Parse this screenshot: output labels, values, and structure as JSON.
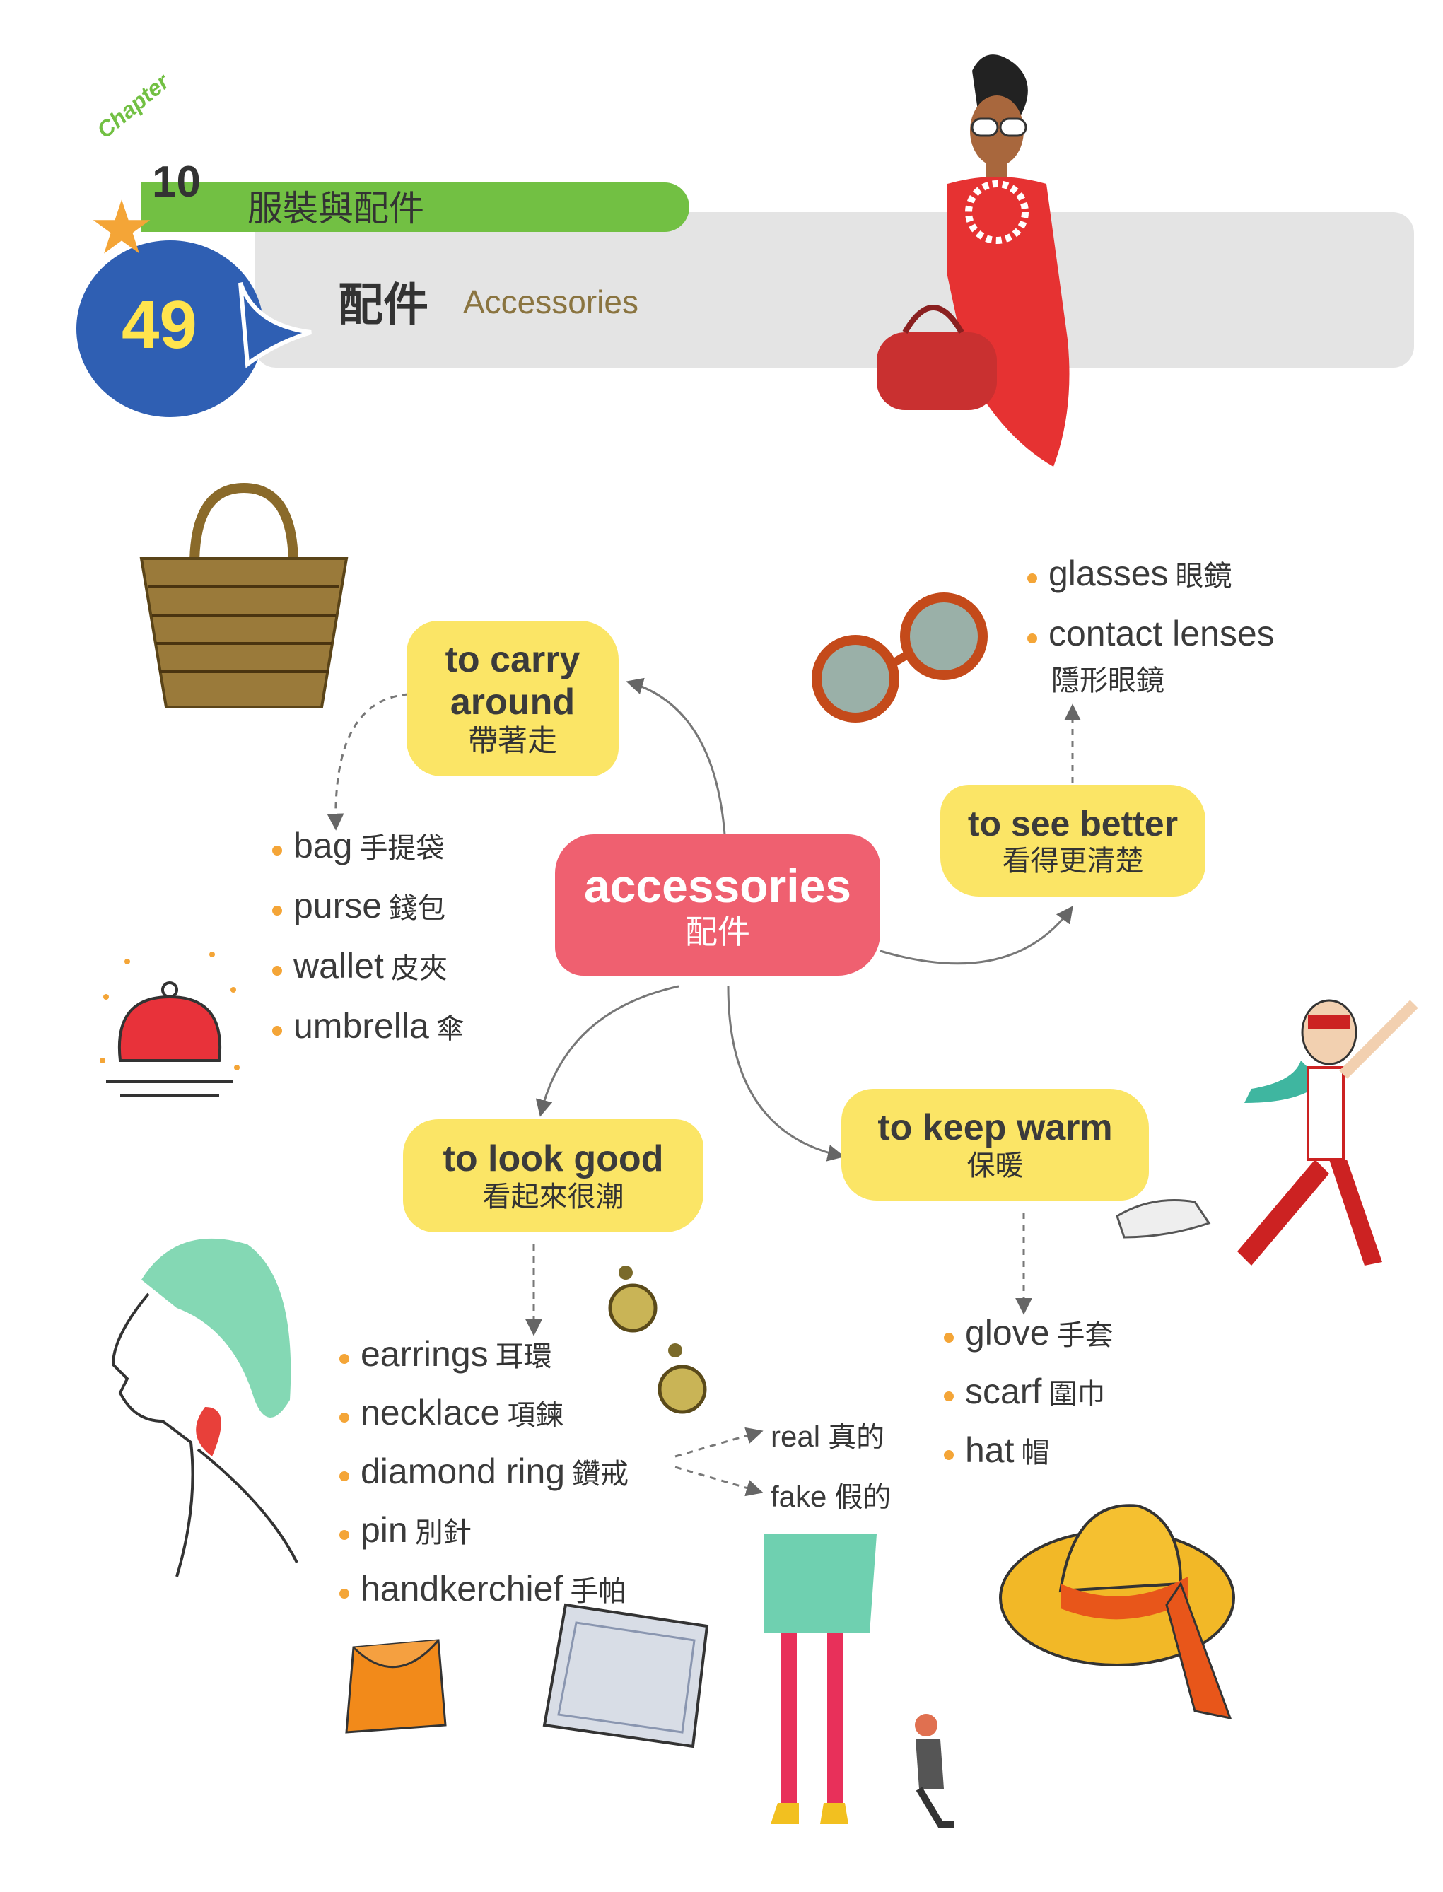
{
  "header": {
    "chapter_word": "Chapter",
    "chapter_number": "10",
    "chapter_title": "服裝與配件",
    "unit_number": "49",
    "unit_title_cn": "配件",
    "unit_title_en": "Accessories"
  },
  "center": {
    "en": "accessories",
    "cn": "配件"
  },
  "branches": {
    "carry": {
      "en_line1": "to carry",
      "en_line2": "around",
      "cn": "帶著走",
      "items": [
        {
          "en": "bag",
          "cn": "手提袋"
        },
        {
          "en": "purse",
          "cn": "錢包"
        },
        {
          "en": "wallet",
          "cn": "皮夾"
        },
        {
          "en": "umbrella",
          "cn": "傘"
        }
      ]
    },
    "see": {
      "en": "to see better",
      "cn": "看得更清楚",
      "items": [
        {
          "en": "glasses",
          "cn": "眼鏡"
        },
        {
          "en": "contact lenses",
          "cn": ""
        }
      ],
      "contact_lenses_cn": "隱形眼鏡"
    },
    "look": {
      "en": "to look good",
      "cn": "看起來很潮",
      "items": [
        {
          "en": "earrings",
          "cn": "耳環"
        },
        {
          "en": "necklace",
          "cn": "項鍊"
        },
        {
          "en": "diamond ring",
          "cn": "鑽戒"
        },
        {
          "en": "pin",
          "cn": "別針"
        },
        {
          "en": "handkerchief",
          "cn": "手帕"
        }
      ],
      "ring_options": [
        {
          "en": "real",
          "cn": "真的"
        },
        {
          "en": "fake",
          "cn": "假的"
        }
      ]
    },
    "warm": {
      "en": "to keep warm",
      "cn": "保暖",
      "items": [
        {
          "en": "glove",
          "cn": "手套"
        },
        {
          "en": "scarf",
          "cn": "圍巾"
        },
        {
          "en": "hat",
          "cn": "帽"
        }
      ]
    }
  },
  "colors": {
    "center": "#ef6070",
    "node": "#fbe566",
    "bullet": "#f4a537",
    "chapter_bar": "#72c043",
    "unit_circle": "#2f5fb3"
  },
  "illustrations": [
    "woman-red-dress",
    "basket-bag",
    "sunglasses",
    "coin-purse",
    "man-running-with-dog",
    "woman-profile",
    "earrings",
    "clutch-bag",
    "handkerchief",
    "legs-heels-proposal",
    "hat-with-scarf"
  ]
}
